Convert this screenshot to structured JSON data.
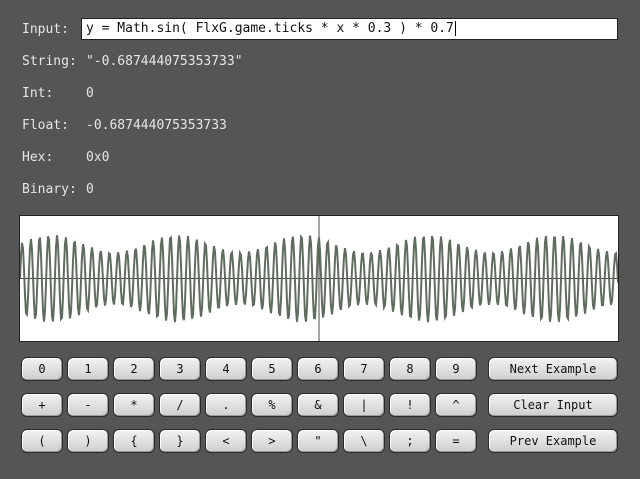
{
  "fields": {
    "input_label": "Input:",
    "input_value": "y = Math.sin( FlxG.game.ticks * x * 0.3 ) * 0.7",
    "string_label": "String:",
    "string_value": "\"-0.687444075353733\"",
    "int_label": "Int:",
    "int_value": "0",
    "float_label": "Float:",
    "float_value": "-0.687444075353733",
    "hex_label": "Hex:",
    "hex_value": "0x0",
    "binary_label": "Binary:",
    "binary_value": "0"
  },
  "keypad": {
    "row1": [
      "0",
      "1",
      "2",
      "3",
      "4",
      "5",
      "6",
      "7",
      "8",
      "9"
    ],
    "row2": [
      "+",
      "-",
      "*",
      "/",
      ".",
      "%",
      "&",
      "|",
      "!",
      "^"
    ],
    "row3": [
      "(",
      ")",
      "{",
      "}",
      "<",
      ">",
      "\"",
      "\\",
      ";",
      "="
    ]
  },
  "actions": {
    "next": "Next Example",
    "clear": "Clear Input",
    "prev": "Prev Example"
  },
  "colors": {
    "background": "#555555",
    "wave": "#5f6d5f",
    "axis": "#4a4a4a"
  }
}
